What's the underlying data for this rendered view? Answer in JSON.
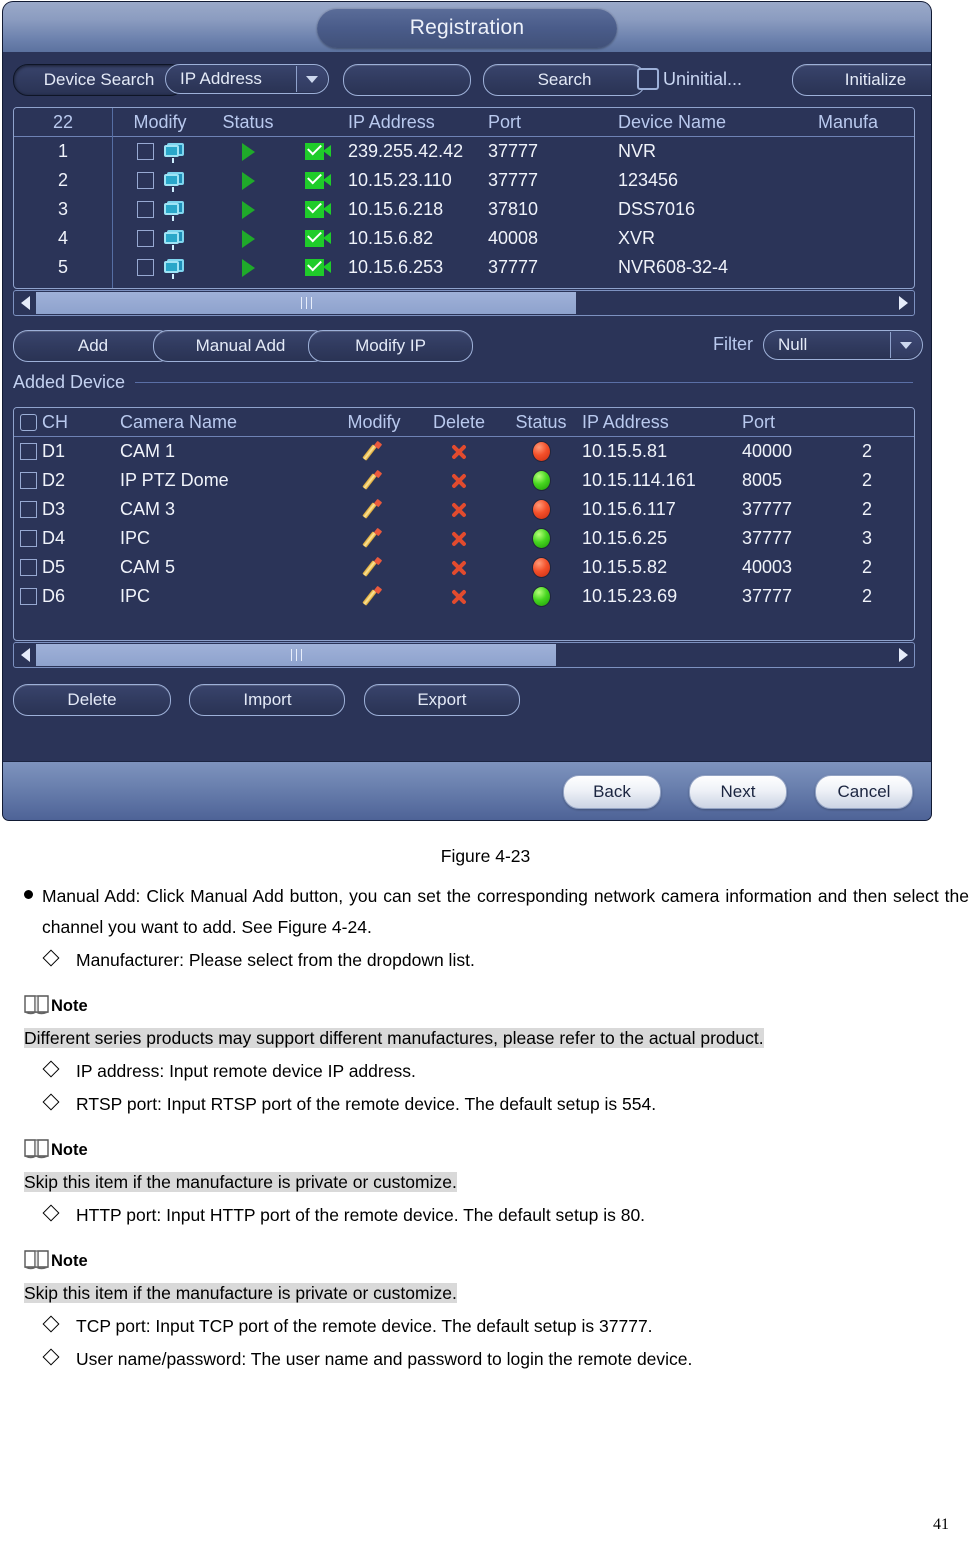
{
  "window": {
    "title": "Registration"
  },
  "toolbar": {
    "device_search_label": "Device Search",
    "search_type_value": "IP Address",
    "search_input_value": "",
    "search_button_label": "Search",
    "uninitialized_checkbox_label": "Uninitial...",
    "uninitialized_checked": false,
    "initialize_label": "Initialize"
  },
  "search_table": {
    "headers": [
      "22",
      "Modify",
      "Status",
      "",
      "IP Address",
      "Port",
      "Device Name",
      "Manufa"
    ],
    "rows": [
      {
        "no": "1",
        "ip": "239.255.42.42",
        "port": "37777",
        "device_name": "NVR",
        "modify_icon": "monitor-icon",
        "status_icon": "play-arrow-icon",
        "check_icon": "camera-check-icon"
      },
      {
        "no": "2",
        "ip": "10.15.23.110",
        "port": "37777",
        "device_name": "123456",
        "modify_icon": "monitor-icon",
        "status_icon": "play-arrow-icon",
        "check_icon": "camera-check-icon"
      },
      {
        "no": "3",
        "ip": "10.15.6.218",
        "port": "37810",
        "device_name": "DSS7016",
        "modify_icon": "monitor-icon",
        "status_icon": "play-arrow-icon",
        "check_icon": "camera-check-icon"
      },
      {
        "no": "4",
        "ip": "10.15.6.82",
        "port": "40008",
        "device_name": "XVR",
        "modify_icon": "monitor-icon",
        "status_icon": "play-arrow-icon",
        "check_icon": "camera-check-icon"
      },
      {
        "no": "5",
        "ip": "10.15.6.253",
        "port": "37777",
        "device_name": "NVR608-32-4",
        "modify_icon": "monitor-icon",
        "status_icon": "play-arrow-icon",
        "check_icon": "camera-check-icon"
      }
    ]
  },
  "action_row": {
    "add_label": "Add",
    "manual_add_label": "Manual Add",
    "modify_ip_label": "Modify IP",
    "filter_label": "Filter",
    "filter_value": "Null"
  },
  "added_device": {
    "section_label": "Added Device",
    "headers": [
      "CH",
      "Camera Name",
      "Modify",
      "Delete",
      "Status",
      "IP Address",
      "Port",
      ""
    ],
    "rows": [
      {
        "ch": "D1",
        "camera_name": "CAM 1",
        "ip": "10.15.5.81",
        "port": "40000",
        "status": "red",
        "trailing": "2"
      },
      {
        "ch": "D2",
        "camera_name": "IP PTZ Dome",
        "ip": "10.15.114.161",
        "port": "8005",
        "status": "green",
        "trailing": "2"
      },
      {
        "ch": "D3",
        "camera_name": "CAM 3",
        "ip": "10.15.6.117",
        "port": "37777",
        "status": "red",
        "trailing": "2"
      },
      {
        "ch": "D4",
        "camera_name": "IPC",
        "ip": "10.15.6.25",
        "port": "37777",
        "status": "green",
        "trailing": "3"
      },
      {
        "ch": "D5",
        "camera_name": "CAM 5",
        "ip": "10.15.5.82",
        "port": "40003",
        "status": "red",
        "trailing": "2"
      },
      {
        "ch": "D6",
        "camera_name": "IPC",
        "ip": "10.15.23.69",
        "port": "37777",
        "status": "green",
        "trailing": "2"
      }
    ],
    "delete_label": "Delete",
    "import_label": "Import",
    "export_label": "Export"
  },
  "footer": {
    "back_label": "Back",
    "next_label": "Next",
    "cancel_label": "Cancel"
  },
  "document": {
    "figure_caption": "Figure 4-23",
    "bullet_manual_add": "Manual Add: Click Manual Add button, you can set the corresponding network camera information and then select the channel you want to add. See Figure 4-24.",
    "item_manufacturer": "Manufacturer: Please select from the dropdown list.",
    "note_label_1": "Note",
    "note_body_1": "Different series products may support different manufactures, please refer to the actual product.",
    "item_ip_address": "IP address: Input remote device IP address.",
    "item_rtsp_port": "RTSP port: Input RTSP port of the remote device. The default setup is 554.",
    "note_label_2": "Note",
    "note_body_2": "Skip this item if the manufacture is private or customize.",
    "item_http_port": "HTTP port: Input HTTP port of the remote device. The default setup is 80.",
    "note_label_3": "Note",
    "note_body_3": "Skip this item if the manufacture is private or customize.",
    "item_tcp_port": "TCP port: Input TCP port of the remote device. The default setup is 37777.",
    "item_user_password": "User name/password: The user name and password to login the remote device.",
    "page_number": "41"
  },
  "colors": {
    "panel_bg": "#2b3458",
    "accent_border": "#9db0d8",
    "status_online": "#47d620",
    "status_offline": "#f4502a",
    "title_text": "#eef2fa"
  }
}
